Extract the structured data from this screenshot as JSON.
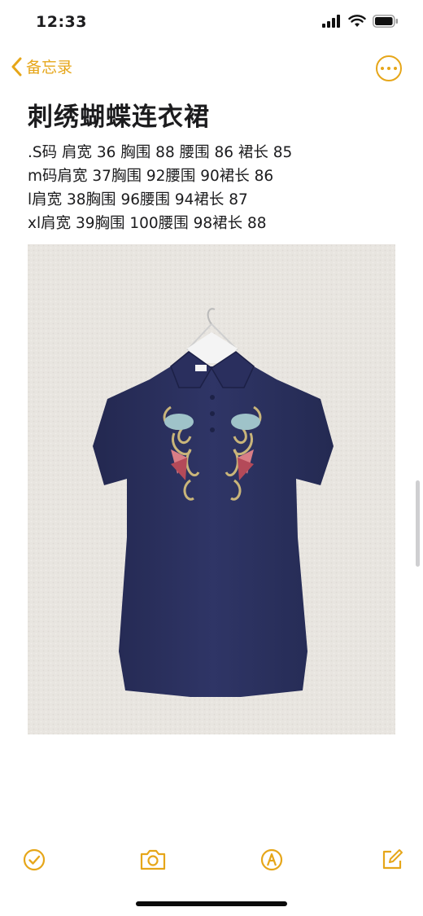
{
  "status_bar": {
    "time": "12:33"
  },
  "nav": {
    "back_label": "备忘录"
  },
  "note": {
    "title": "刺绣蝴蝶连衣裙",
    "lines": [
      ".S码 肩宽 36 胸围 88 腰围 86 裙长 85",
      "m码肩宽 37胸围 92腰围 90裙长 86",
      "l肩宽 38胸围 96腰围 94裙长 87",
      "xl肩宽 39胸围 100腰围 98裙长 88"
    ]
  },
  "colors": {
    "accent": "#e6a619",
    "dress": "#2c3160",
    "background": "#e9e6e2"
  },
  "toolbar": {
    "icons": [
      "checklist-icon",
      "camera-icon",
      "markup-icon",
      "compose-icon"
    ]
  }
}
